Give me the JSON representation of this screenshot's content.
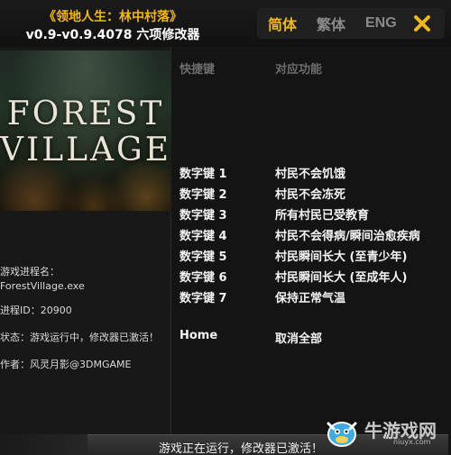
{
  "header": {
    "game_title": "《领地人生：林中村落》",
    "version_title": "v0.9-v0.9.4078 六项修改器"
  },
  "languages": {
    "simplified": "简体",
    "traditional": "繁体",
    "english": "ENG",
    "close_icon": "close-x-icon",
    "active_color": "#f2b61f",
    "inactive_color": "#8a8a8a"
  },
  "cover": {
    "line1": "FOREST",
    "line2": "VILLAGE"
  },
  "info": {
    "process_label": "游戏进程名：",
    "process_value": "ForestVillage.exe",
    "pid_label": "进程ID：",
    "pid_value": "20900",
    "status": "状态：游戏运行中，修改器已激活！",
    "author": "作者：风灵月影@3DMGAME"
  },
  "table": {
    "header_key": "快捷键",
    "header_func": "对应功能",
    "rows": [
      {
        "key": "数字键 1",
        "func": "村民不会饥饿"
      },
      {
        "key": "数字键 2",
        "func": "村民不会冻死"
      },
      {
        "key": "数字键 3",
        "func": "所有村民已受教育"
      },
      {
        "key": "数字键 4",
        "func": "村民不会得病/瞬间治愈疾病"
      },
      {
        "key": "数字键 5",
        "func": "村民瞬间长大 (至青少年)"
      },
      {
        "key": "数字键 6",
        "func": "村民瞬间长大 (至成年人)"
      },
      {
        "key": "数字键 7",
        "func": "保持正常气温"
      }
    ],
    "home_key": "Home",
    "home_func": "取消全部"
  },
  "status_bar": {
    "text": "游戏正在运行，修改器已激活！"
  },
  "watermark": {
    "text": "牛游戏网",
    "url": "niuyx.com"
  }
}
